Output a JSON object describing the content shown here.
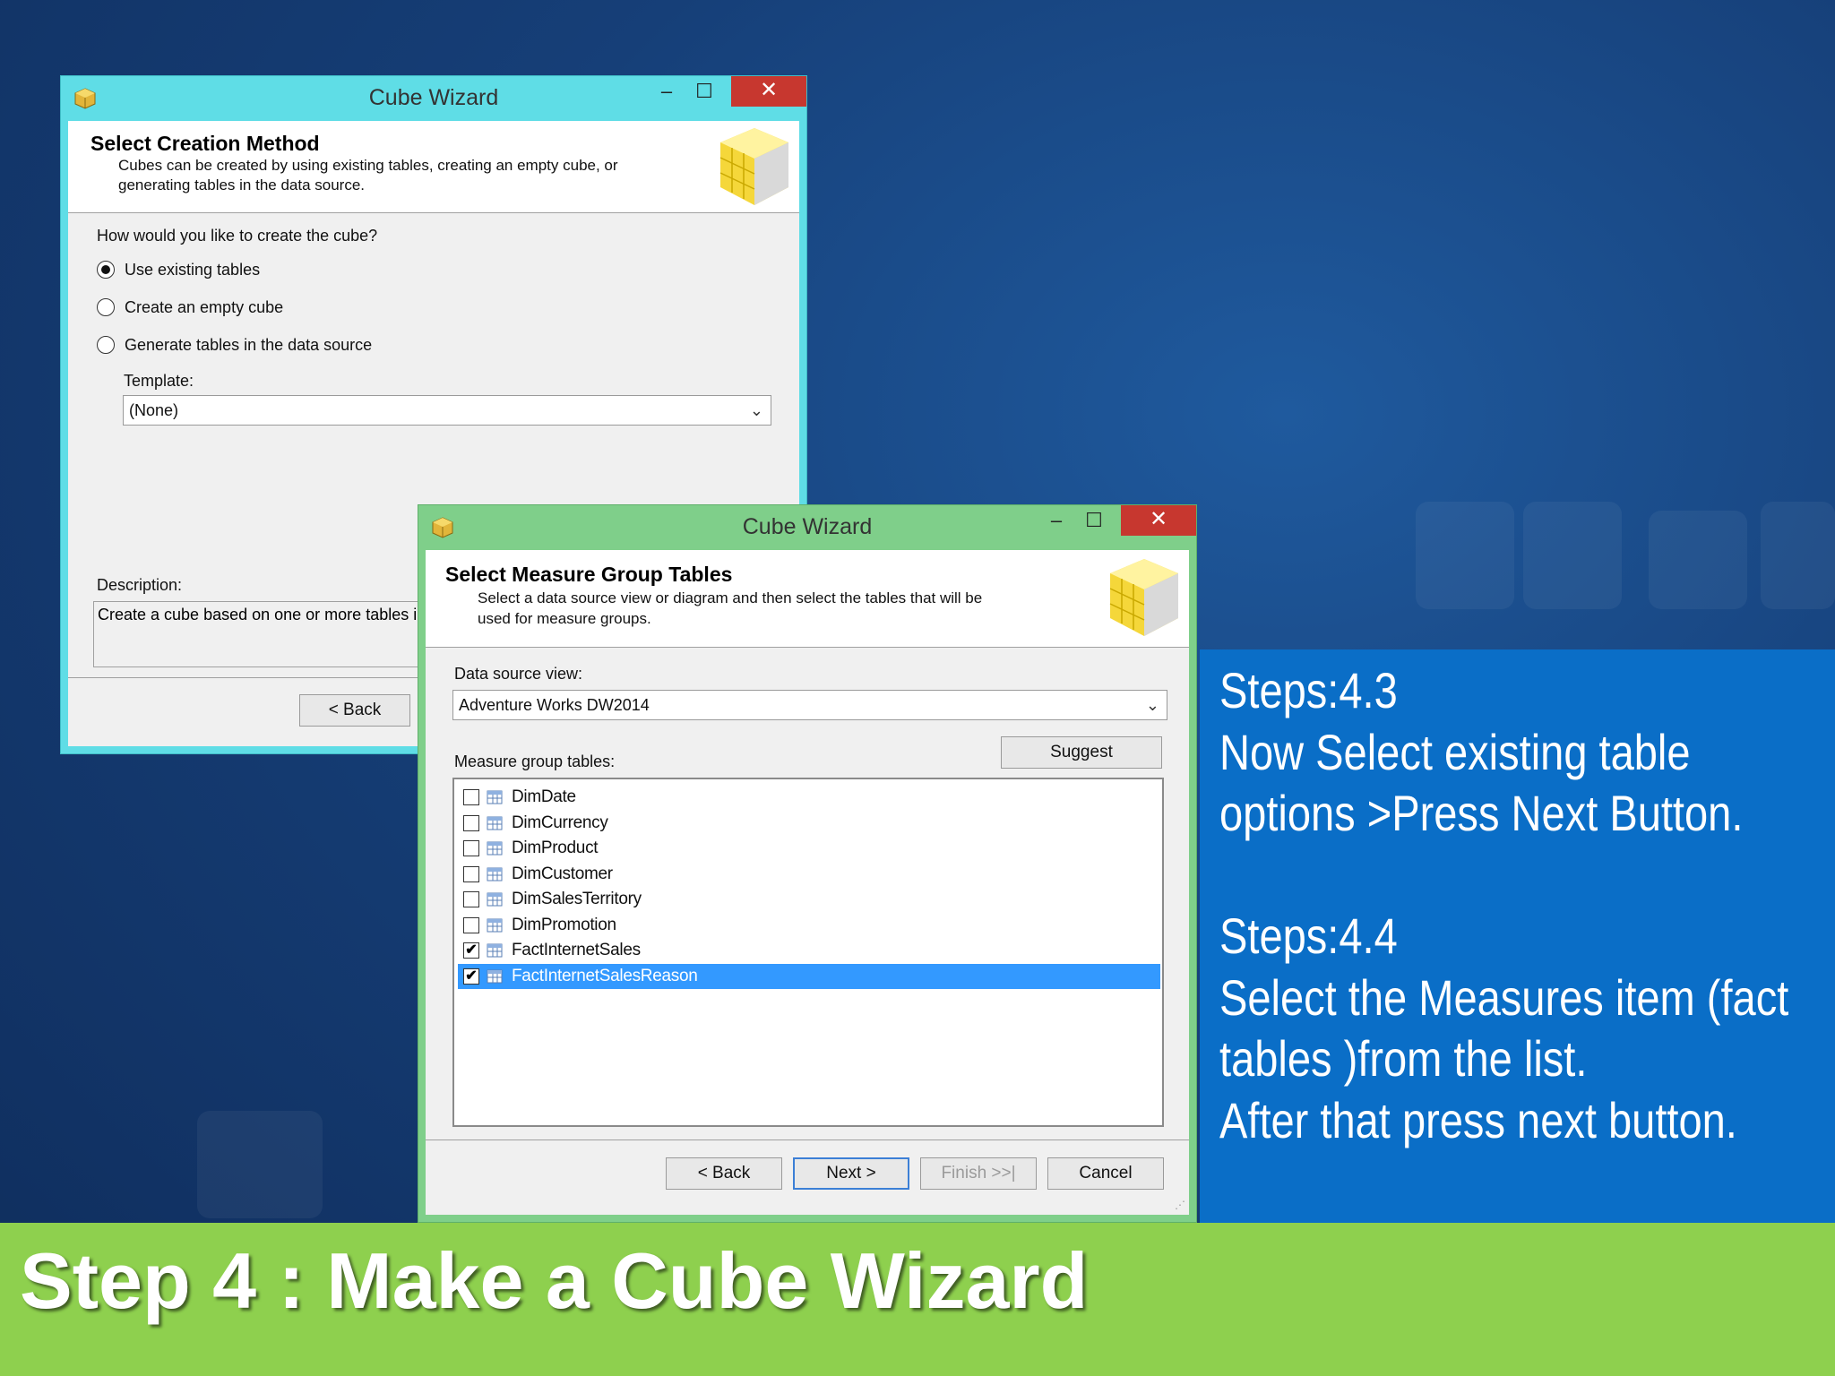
{
  "slide": {
    "title": "Step 4 : Make a Cube Wizard"
  },
  "instructions": {
    "lines": [
      "Steps:4.3",
      "Now Select existing table",
      "options >Press Next Button.",
      "",
      "Steps:4.4",
      "Select the Measures item (fact",
      "tables )from the list.",
      "After that press next button."
    ]
  },
  "wizard1": {
    "title": "Cube Wizard",
    "minimize": "–",
    "maximize": "☐",
    "close": "✕",
    "header_title": "Select Creation Method",
    "header_sub_1": "Cubes can be created by using existing tables, creating an empty cube, or",
    "header_sub_2": "generating tables in the data source.",
    "question": "How would you like to create the cube?",
    "options": [
      {
        "label": "Use existing tables",
        "selected": true
      },
      {
        "label": "Create an empty cube",
        "selected": false
      },
      {
        "label": "Generate tables in the data source",
        "selected": false
      }
    ],
    "template_label": "Template:",
    "template_value": "(None)",
    "description_label": "Description:",
    "description_text": "Create a cube based on one or more tables in",
    "back_button": "< Back"
  },
  "wizard2": {
    "title": "Cube Wizard",
    "minimize": "–",
    "maximize": "☐",
    "close": "✕",
    "header_title": "Select Measure Group Tables",
    "header_sub_1": "Select a data source view or diagram and then select the tables that will be",
    "header_sub_2": "used for measure groups.",
    "dsv_label": "Data source view:",
    "dsv_value": "Adventure Works DW2014",
    "suggest_button": "Suggest",
    "tables_label": "Measure group tables:",
    "tables": [
      {
        "name": "DimDate",
        "checked": false,
        "selected": false
      },
      {
        "name": "DimCurrency",
        "checked": false,
        "selected": false
      },
      {
        "name": "DimProduct",
        "checked": false,
        "selected": false
      },
      {
        "name": "DimCustomer",
        "checked": false,
        "selected": false
      },
      {
        "name": "DimSalesTerritory",
        "checked": false,
        "selected": false
      },
      {
        "name": "DimPromotion",
        "checked": false,
        "selected": false
      },
      {
        "name": "FactInternetSales",
        "checked": true,
        "selected": false
      },
      {
        "name": "FactInternetSalesReason",
        "checked": true,
        "selected": true
      }
    ],
    "back_button": "< Back",
    "next_button": "Next >",
    "finish_button": "Finish >>|",
    "cancel_button": "Cancel",
    "grip": "⋰"
  },
  "colors": {
    "wizard1_frame": "#5fdde6",
    "wizard2_frame": "#7fcf8a",
    "close_button": "#c7372f",
    "selection": "#3399ff",
    "instruction_panel": "#0a6ec7",
    "title_bar": "#8ed04e"
  }
}
